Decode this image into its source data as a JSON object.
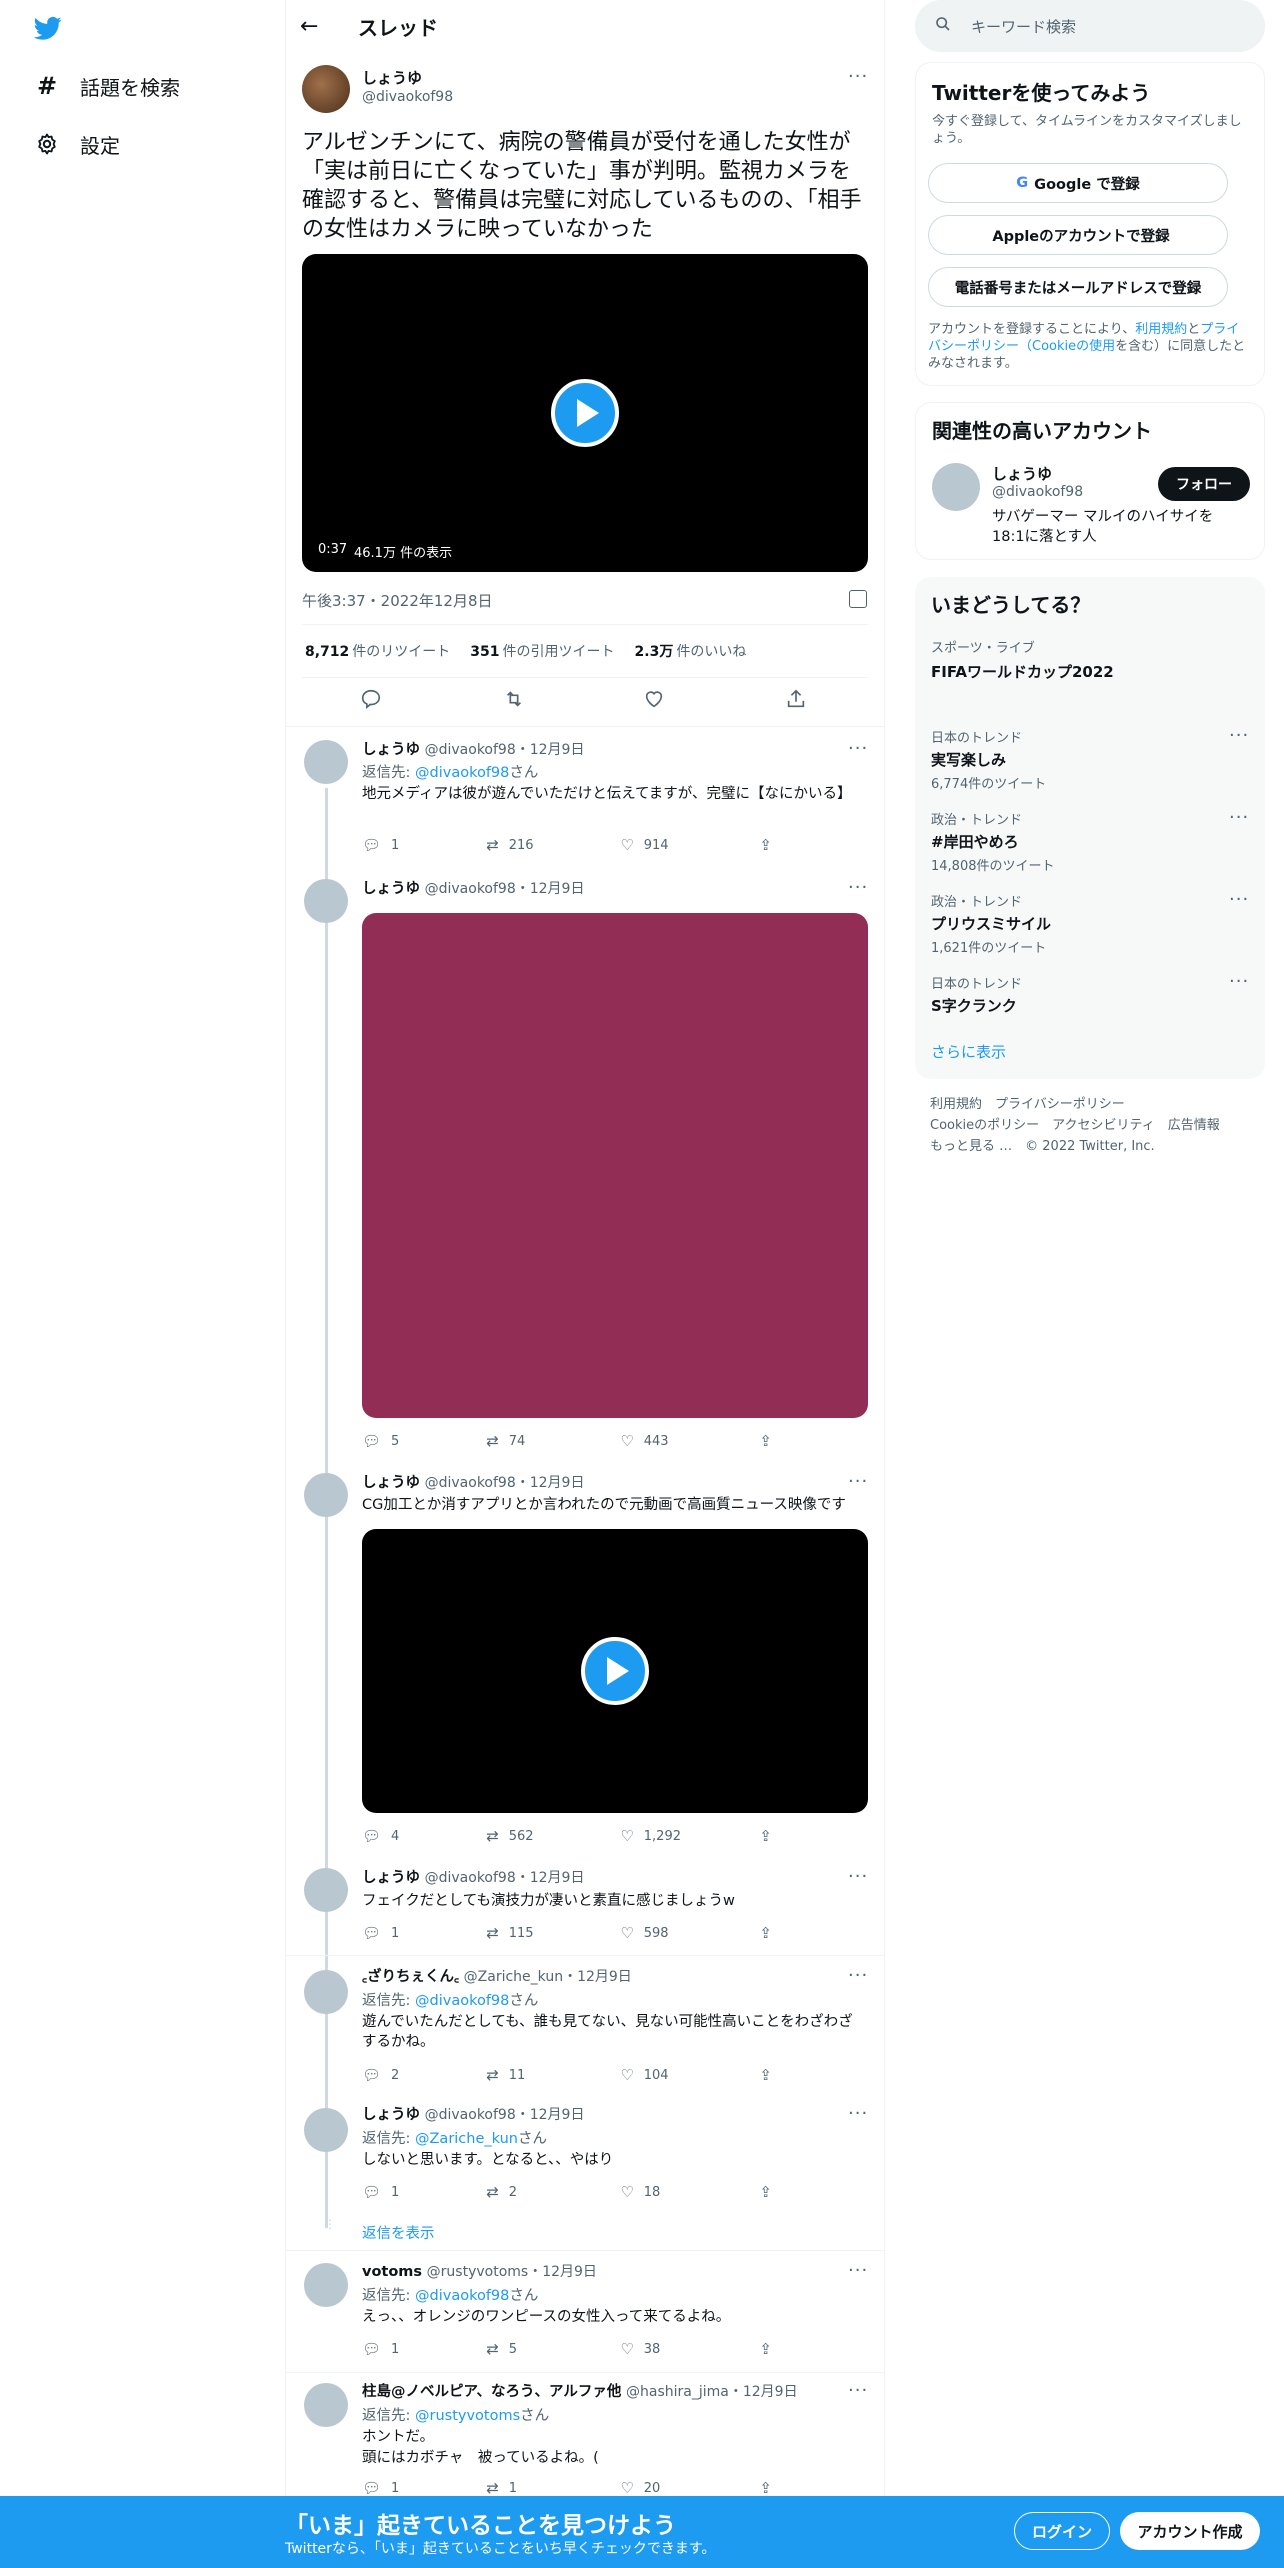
{
  "nav": {
    "explore": "話題を検索",
    "settings": "設定"
  },
  "header": {
    "title": "スレッド"
  },
  "main_tweet": {
    "name": "しょうゆ",
    "handle": "@divaokof98",
    "text": "アルゼンチンにて、病院の警備員が受付を通した女性が「実は前日に亡くなっていた」事が判明。監視カメラを確認すると、警備員は完璧に対応しているものの、「相手の女性はカメラに映っていなかった",
    "video_time": "0:37",
    "video_views": "46.1万 件の表示",
    "timestamp": "午後3:37・2022年12月8日",
    "retweets": "8,712",
    "retweets_label": "件のリツイート",
    "quotes": "351",
    "quotes_label": "件の引用ツイート",
    "likes": "2.3万",
    "likes_label": "件のいいね"
  },
  "replies": [
    {
      "name": "しょうゆ",
      "handle": "@divaokof98",
      "date": "・12月9日",
      "replyto_prefix": "返信先: ",
      "replyto": "@divaokof98",
      "replyto_suffix": "さん",
      "text": "地元メディアは彼が遊んでいただけと伝えてますが、完璧に【なにかいる】",
      "c": "1",
      "r": "216",
      "l": "914"
    },
    {
      "name": "しょうゆ",
      "handle": "@divaokof98",
      "date": "・12月9日",
      "c": "5",
      "r": "74",
      "l": "443"
    },
    {
      "name": "しょうゆ",
      "handle": "@divaokof98",
      "date": "・12月9日",
      "text": "CG加工とか消すアプリとか言われたので元動画で高画質ニュース映像です",
      "c": "4",
      "r": "562",
      "l": "1,292"
    },
    {
      "name": "しょうゆ",
      "handle": "@divaokof98",
      "date": "・12月9日",
      "text": "フェイクだとしても演技力が凄いと素直に感じましょうw",
      "c": "1",
      "r": "115",
      "l": "598"
    },
    {
      "name": "꜀ざりちぇくん꜀",
      "handle": "@Zariche_kun",
      "date": "・12月9日",
      "replyto_prefix": "返信先: ",
      "replyto": "@divaokof98",
      "replyto_suffix": "さん",
      "text": "遊んでいたんだとしても、誰も見てない、見ない可能性高いことをわざわざするかね。",
      "c": "2",
      "r": "11",
      "l": "104"
    },
    {
      "name": "しょうゆ",
      "handle": "@divaokof98",
      "date": "・12月9日",
      "replyto_prefix": "返信先: ",
      "replyto": "@Zariche_kun",
      "replyto_suffix": "さん",
      "text": "しないと思います。となると、、やはり",
      "c": "1",
      "r": "2",
      "l": "18"
    },
    {
      "name": "votoms",
      "handle": "@rustyvotoms",
      "date": "・12月9日",
      "replyto_prefix": "返信先: ",
      "replyto": "@divaokof98",
      "replyto_suffix": "さん",
      "text": "えっ、、オレンジのワンピースの女性入って来てるよね。",
      "c": "1",
      "r": "5",
      "l": "38"
    },
    {
      "name": "柱島@ノベルピア、なろう、アルファ他",
      "handle": "@hashira_jima",
      "date": "・12月9日",
      "replyto_prefix": "返信先: ",
      "replyto": "@rustyvotoms",
      "replyto_suffix": "さん",
      "text1": "ホントだ。",
      "text2": "頭にはカボチャ　被っているよね。(",
      "c": "1",
      "r": "1",
      "l": "20"
    }
  ],
  "show_replies": "返信を表示",
  "search": {
    "placeholder": "キーワード検索"
  },
  "signup": {
    "title": "Twitterを使ってみよう",
    "desc": "今すぐ登録して、タイムラインをカスタマイズしましょう。",
    "google": "Google で登録",
    "apple": "Appleのアカウントで登録",
    "phone": "電話番号またはメールアドレスで登録",
    "legal1": "アカウントを登録することにより、",
    "legal_link1": "利用規約",
    "legal2": "と",
    "legal_link2": "プライバシーポリシー（Cookieの使用",
    "legal3": "を含む）に同意したとみなされます。"
  },
  "related": {
    "title": "関連性の高いアカウント",
    "name": "しょうゆ",
    "handle": "@divaokof98",
    "follow": "フォロー",
    "bio": "サバゲーマー マルイのハイサイを18:1に落とす人"
  },
  "trends": {
    "title": "いまどうしてる？",
    "items": [
      {
        "cat": "スポーツ・ライブ",
        "name": "FIFAワールドカップ2022",
        "count": ""
      },
      {
        "cat": "日本のトレンド",
        "name": "実写楽しみ",
        "count": "6,774件のツイート"
      },
      {
        "cat": "政治・トレンド",
        "name": "#岸田やめろ",
        "count": "14,808件のツイート"
      },
      {
        "cat": "政治・トレンド",
        "name": "プリウスミサイル",
        "count": "1,621件のツイート"
      },
      {
        "cat": "日本のトレンド",
        "name": "S字クランク",
        "count": ""
      }
    ],
    "show_more": "さらに表示"
  },
  "footer": {
    "terms": "利用規約",
    "privacy": "プライバシーポリシー",
    "cookie": "Cookieのポリシー",
    "access": "アクセシビリティ",
    "ads": "広告情報",
    "more": "もっと見る …",
    "copy": "© 2022 Twitter, Inc."
  },
  "banner": {
    "title": "「いま」起きていることを見つけよう",
    "sub": "Twitterなら、「いま」起きていることをいち早くチェックできます。",
    "login": "ログイン",
    "signup": "アカウント作成"
  },
  "colors": {
    "accent": "#1d9bf0",
    "image_tile": "#922e55"
  }
}
